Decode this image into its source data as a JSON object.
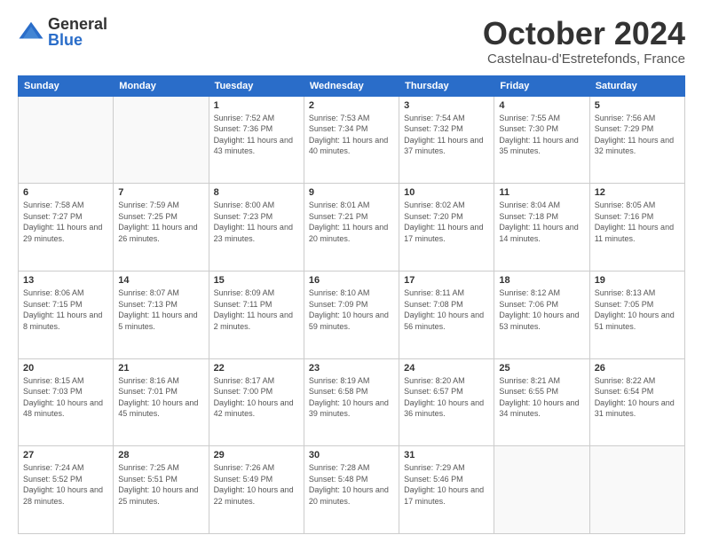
{
  "logo": {
    "general": "General",
    "blue": "Blue"
  },
  "title": "October 2024",
  "location": "Castelnau-d'Estretefonds, France",
  "weekdays": [
    "Sunday",
    "Monday",
    "Tuesday",
    "Wednesday",
    "Thursday",
    "Friday",
    "Saturday"
  ],
  "weeks": [
    [
      {
        "day": "",
        "sunrise": "",
        "sunset": "",
        "daylight": ""
      },
      {
        "day": "",
        "sunrise": "",
        "sunset": "",
        "daylight": ""
      },
      {
        "day": "1",
        "sunrise": "Sunrise: 7:52 AM",
        "sunset": "Sunset: 7:36 PM",
        "daylight": "Daylight: 11 hours and 43 minutes."
      },
      {
        "day": "2",
        "sunrise": "Sunrise: 7:53 AM",
        "sunset": "Sunset: 7:34 PM",
        "daylight": "Daylight: 11 hours and 40 minutes."
      },
      {
        "day": "3",
        "sunrise": "Sunrise: 7:54 AM",
        "sunset": "Sunset: 7:32 PM",
        "daylight": "Daylight: 11 hours and 37 minutes."
      },
      {
        "day": "4",
        "sunrise": "Sunrise: 7:55 AM",
        "sunset": "Sunset: 7:30 PM",
        "daylight": "Daylight: 11 hours and 35 minutes."
      },
      {
        "day": "5",
        "sunrise": "Sunrise: 7:56 AM",
        "sunset": "Sunset: 7:29 PM",
        "daylight": "Daylight: 11 hours and 32 minutes."
      }
    ],
    [
      {
        "day": "6",
        "sunrise": "Sunrise: 7:58 AM",
        "sunset": "Sunset: 7:27 PM",
        "daylight": "Daylight: 11 hours and 29 minutes."
      },
      {
        "day": "7",
        "sunrise": "Sunrise: 7:59 AM",
        "sunset": "Sunset: 7:25 PM",
        "daylight": "Daylight: 11 hours and 26 minutes."
      },
      {
        "day": "8",
        "sunrise": "Sunrise: 8:00 AM",
        "sunset": "Sunset: 7:23 PM",
        "daylight": "Daylight: 11 hours and 23 minutes."
      },
      {
        "day": "9",
        "sunrise": "Sunrise: 8:01 AM",
        "sunset": "Sunset: 7:21 PM",
        "daylight": "Daylight: 11 hours and 20 minutes."
      },
      {
        "day": "10",
        "sunrise": "Sunrise: 8:02 AM",
        "sunset": "Sunset: 7:20 PM",
        "daylight": "Daylight: 11 hours and 17 minutes."
      },
      {
        "day": "11",
        "sunrise": "Sunrise: 8:04 AM",
        "sunset": "Sunset: 7:18 PM",
        "daylight": "Daylight: 11 hours and 14 minutes."
      },
      {
        "day": "12",
        "sunrise": "Sunrise: 8:05 AM",
        "sunset": "Sunset: 7:16 PM",
        "daylight": "Daylight: 11 hours and 11 minutes."
      }
    ],
    [
      {
        "day": "13",
        "sunrise": "Sunrise: 8:06 AM",
        "sunset": "Sunset: 7:15 PM",
        "daylight": "Daylight: 11 hours and 8 minutes."
      },
      {
        "day": "14",
        "sunrise": "Sunrise: 8:07 AM",
        "sunset": "Sunset: 7:13 PM",
        "daylight": "Daylight: 11 hours and 5 minutes."
      },
      {
        "day": "15",
        "sunrise": "Sunrise: 8:09 AM",
        "sunset": "Sunset: 7:11 PM",
        "daylight": "Daylight: 11 hours and 2 minutes."
      },
      {
        "day": "16",
        "sunrise": "Sunrise: 8:10 AM",
        "sunset": "Sunset: 7:09 PM",
        "daylight": "Daylight: 10 hours and 59 minutes."
      },
      {
        "day": "17",
        "sunrise": "Sunrise: 8:11 AM",
        "sunset": "Sunset: 7:08 PM",
        "daylight": "Daylight: 10 hours and 56 minutes."
      },
      {
        "day": "18",
        "sunrise": "Sunrise: 8:12 AM",
        "sunset": "Sunset: 7:06 PM",
        "daylight": "Daylight: 10 hours and 53 minutes."
      },
      {
        "day": "19",
        "sunrise": "Sunrise: 8:13 AM",
        "sunset": "Sunset: 7:05 PM",
        "daylight": "Daylight: 10 hours and 51 minutes."
      }
    ],
    [
      {
        "day": "20",
        "sunrise": "Sunrise: 8:15 AM",
        "sunset": "Sunset: 7:03 PM",
        "daylight": "Daylight: 10 hours and 48 minutes."
      },
      {
        "day": "21",
        "sunrise": "Sunrise: 8:16 AM",
        "sunset": "Sunset: 7:01 PM",
        "daylight": "Daylight: 10 hours and 45 minutes."
      },
      {
        "day": "22",
        "sunrise": "Sunrise: 8:17 AM",
        "sunset": "Sunset: 7:00 PM",
        "daylight": "Daylight: 10 hours and 42 minutes."
      },
      {
        "day": "23",
        "sunrise": "Sunrise: 8:19 AM",
        "sunset": "Sunset: 6:58 PM",
        "daylight": "Daylight: 10 hours and 39 minutes."
      },
      {
        "day": "24",
        "sunrise": "Sunrise: 8:20 AM",
        "sunset": "Sunset: 6:57 PM",
        "daylight": "Daylight: 10 hours and 36 minutes."
      },
      {
        "day": "25",
        "sunrise": "Sunrise: 8:21 AM",
        "sunset": "Sunset: 6:55 PM",
        "daylight": "Daylight: 10 hours and 34 minutes."
      },
      {
        "day": "26",
        "sunrise": "Sunrise: 8:22 AM",
        "sunset": "Sunset: 6:54 PM",
        "daylight": "Daylight: 10 hours and 31 minutes."
      }
    ],
    [
      {
        "day": "27",
        "sunrise": "Sunrise: 7:24 AM",
        "sunset": "Sunset: 5:52 PM",
        "daylight": "Daylight: 10 hours and 28 minutes."
      },
      {
        "day": "28",
        "sunrise": "Sunrise: 7:25 AM",
        "sunset": "Sunset: 5:51 PM",
        "daylight": "Daylight: 10 hours and 25 minutes."
      },
      {
        "day": "29",
        "sunrise": "Sunrise: 7:26 AM",
        "sunset": "Sunset: 5:49 PM",
        "daylight": "Daylight: 10 hours and 22 minutes."
      },
      {
        "day": "30",
        "sunrise": "Sunrise: 7:28 AM",
        "sunset": "Sunset: 5:48 PM",
        "daylight": "Daylight: 10 hours and 20 minutes."
      },
      {
        "day": "31",
        "sunrise": "Sunrise: 7:29 AM",
        "sunset": "Sunset: 5:46 PM",
        "daylight": "Daylight: 10 hours and 17 minutes."
      },
      {
        "day": "",
        "sunrise": "",
        "sunset": "",
        "daylight": ""
      },
      {
        "day": "",
        "sunrise": "",
        "sunset": "",
        "daylight": ""
      }
    ]
  ]
}
